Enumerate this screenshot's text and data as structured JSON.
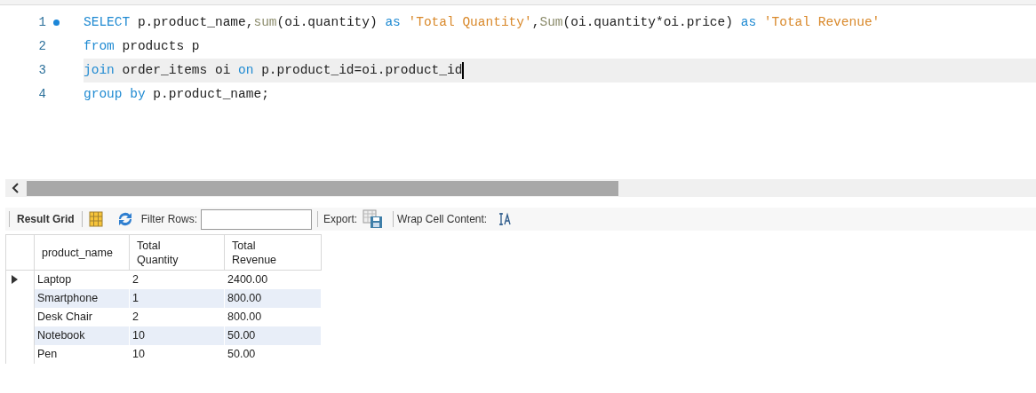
{
  "editor": {
    "lines": [
      {
        "number": "1",
        "breakpoint": true,
        "current": false,
        "tokens": [
          {
            "kind": "keyword",
            "text": "SELECT"
          },
          {
            "kind": "plain",
            "text": " p.product_name,"
          },
          {
            "kind": "function",
            "text": "sum"
          },
          {
            "kind": "plain",
            "text": "(oi.quantity) "
          },
          {
            "kind": "keyword",
            "text": "as"
          },
          {
            "kind": "string",
            "text": " 'Total Quantity'"
          },
          {
            "kind": "plain",
            "text": ","
          },
          {
            "kind": "function",
            "text": "Sum"
          },
          {
            "kind": "plain",
            "text": "(oi.quantity*oi.price) "
          },
          {
            "kind": "keyword",
            "text": "as"
          },
          {
            "kind": "string",
            "text": " 'Total Revenue'"
          }
        ]
      },
      {
        "number": "2",
        "breakpoint": false,
        "current": false,
        "tokens": [
          {
            "kind": "keyword",
            "text": "from"
          },
          {
            "kind": "plain",
            "text": " products p"
          }
        ]
      },
      {
        "number": "3",
        "breakpoint": false,
        "current": true,
        "tokens": [
          {
            "kind": "keyword",
            "text": "join"
          },
          {
            "kind": "plain",
            "text": " order_items oi "
          },
          {
            "kind": "keyword",
            "text": "on"
          },
          {
            "kind": "plain",
            "text": " p.product_id=oi.product_id"
          }
        ]
      },
      {
        "number": "4",
        "breakpoint": false,
        "current": false,
        "tokens": [
          {
            "kind": "keyword",
            "text": "group by"
          },
          {
            "kind": "plain",
            "text": " p.product_name;"
          }
        ]
      }
    ]
  },
  "result_toolbar": {
    "result_grid": "Result Grid",
    "filter_label": "Filter Rows:",
    "export_label": "Export:",
    "wrap_label": "Wrap Cell Content:"
  },
  "grid": {
    "columns": [
      "product_name",
      "Total Quantity",
      "Total Revenue"
    ],
    "rows": [
      {
        "selected": true,
        "cells": [
          "Laptop",
          "2",
          "2400.00"
        ]
      },
      {
        "selected": false,
        "cells": [
          "Smartphone",
          "1",
          "800.00"
        ]
      },
      {
        "selected": false,
        "cells": [
          "Desk Chair",
          "2",
          "800.00"
        ]
      },
      {
        "selected": false,
        "cells": [
          "Notebook",
          "10",
          "50.00"
        ]
      },
      {
        "selected": false,
        "cells": [
          "Pen",
          "10",
          "50.00"
        ]
      }
    ]
  }
}
